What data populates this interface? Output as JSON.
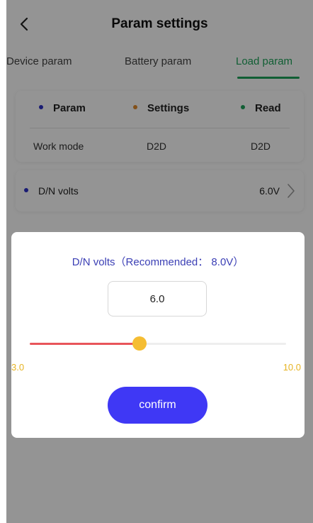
{
  "header": {
    "back_icon": "chevron-left-icon",
    "title": "Param settings"
  },
  "tabs": [
    {
      "label": "Device param",
      "active": false
    },
    {
      "label": "Battery param",
      "active": false
    },
    {
      "label": "Load param",
      "active": true
    }
  ],
  "param_table": {
    "columns": [
      {
        "label": "Param",
        "dot_color": "#2b2fc7"
      },
      {
        "label": "Settings",
        "dot_color": "#e08b2c"
      },
      {
        "label": "Read",
        "dot_color": "#1ea35a"
      }
    ],
    "rows": [
      {
        "param": "Work mode",
        "settings": "D2D",
        "read": "D2D"
      }
    ]
  },
  "dn_row": {
    "label": "D/N volts",
    "value": "6.0V",
    "dot_color": "#2b2fc7",
    "chevron_icon": "chevron-right-icon"
  },
  "dialog": {
    "title": "D/N volts（Recommended： 8.0V）",
    "input_value": "6.0",
    "slider": {
      "min": 3.0,
      "max": 10.0,
      "value": 6.0,
      "fill_color": "#e8555a",
      "thumb_color": "#f5bd33"
    },
    "range_min_label": "3.0",
    "range_max_label": "10.0",
    "confirm_label": "confirm",
    "confirm_color": "#3f38f5"
  },
  "colors": {
    "accent_green": "#1ea35a",
    "dialog_title": "#3b3fb5"
  }
}
